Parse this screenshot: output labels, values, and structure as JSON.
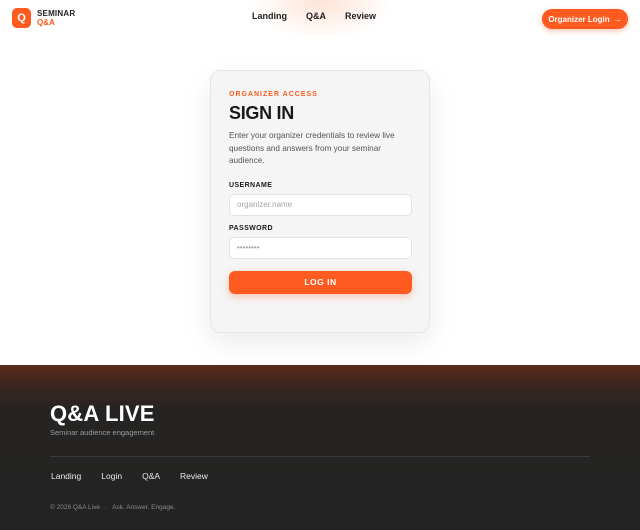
{
  "brand": {
    "logo_letter": "Q",
    "name_line1": "SEMINAR",
    "name_line2": "Q&A",
    "accent_color": "#ff5a1f"
  },
  "nav": {
    "items": [
      {
        "label": "Landing"
      },
      {
        "label": "Q&A"
      },
      {
        "label": "Review"
      }
    ]
  },
  "header": {
    "cta_label": "Organizer Login",
    "cta_icon": "arrow-right-icon",
    "cta_arrow": "→"
  },
  "login": {
    "eyebrow": "ORGANIZER ACCESS",
    "title": "SIGN IN",
    "description": "Enter your organizer credentials to review live questions and answers from your seminar audience.",
    "username_label": "USERNAME",
    "username_placeholder": "organizer.name",
    "password_label": "PASSWORD",
    "password_placeholder": "••••••••",
    "submit_label": "LOG IN"
  },
  "footer": {
    "title": "Q&A LIVE",
    "tagline": "Seminar audience engagement",
    "links": [
      {
        "label": "Landing"
      },
      {
        "label": "Login"
      },
      {
        "label": "Q&A"
      },
      {
        "label": "Review"
      }
    ],
    "copyright": "© 2026 Q&A Live",
    "separator": "·",
    "slogan": "Ask. Answer. Engage."
  }
}
